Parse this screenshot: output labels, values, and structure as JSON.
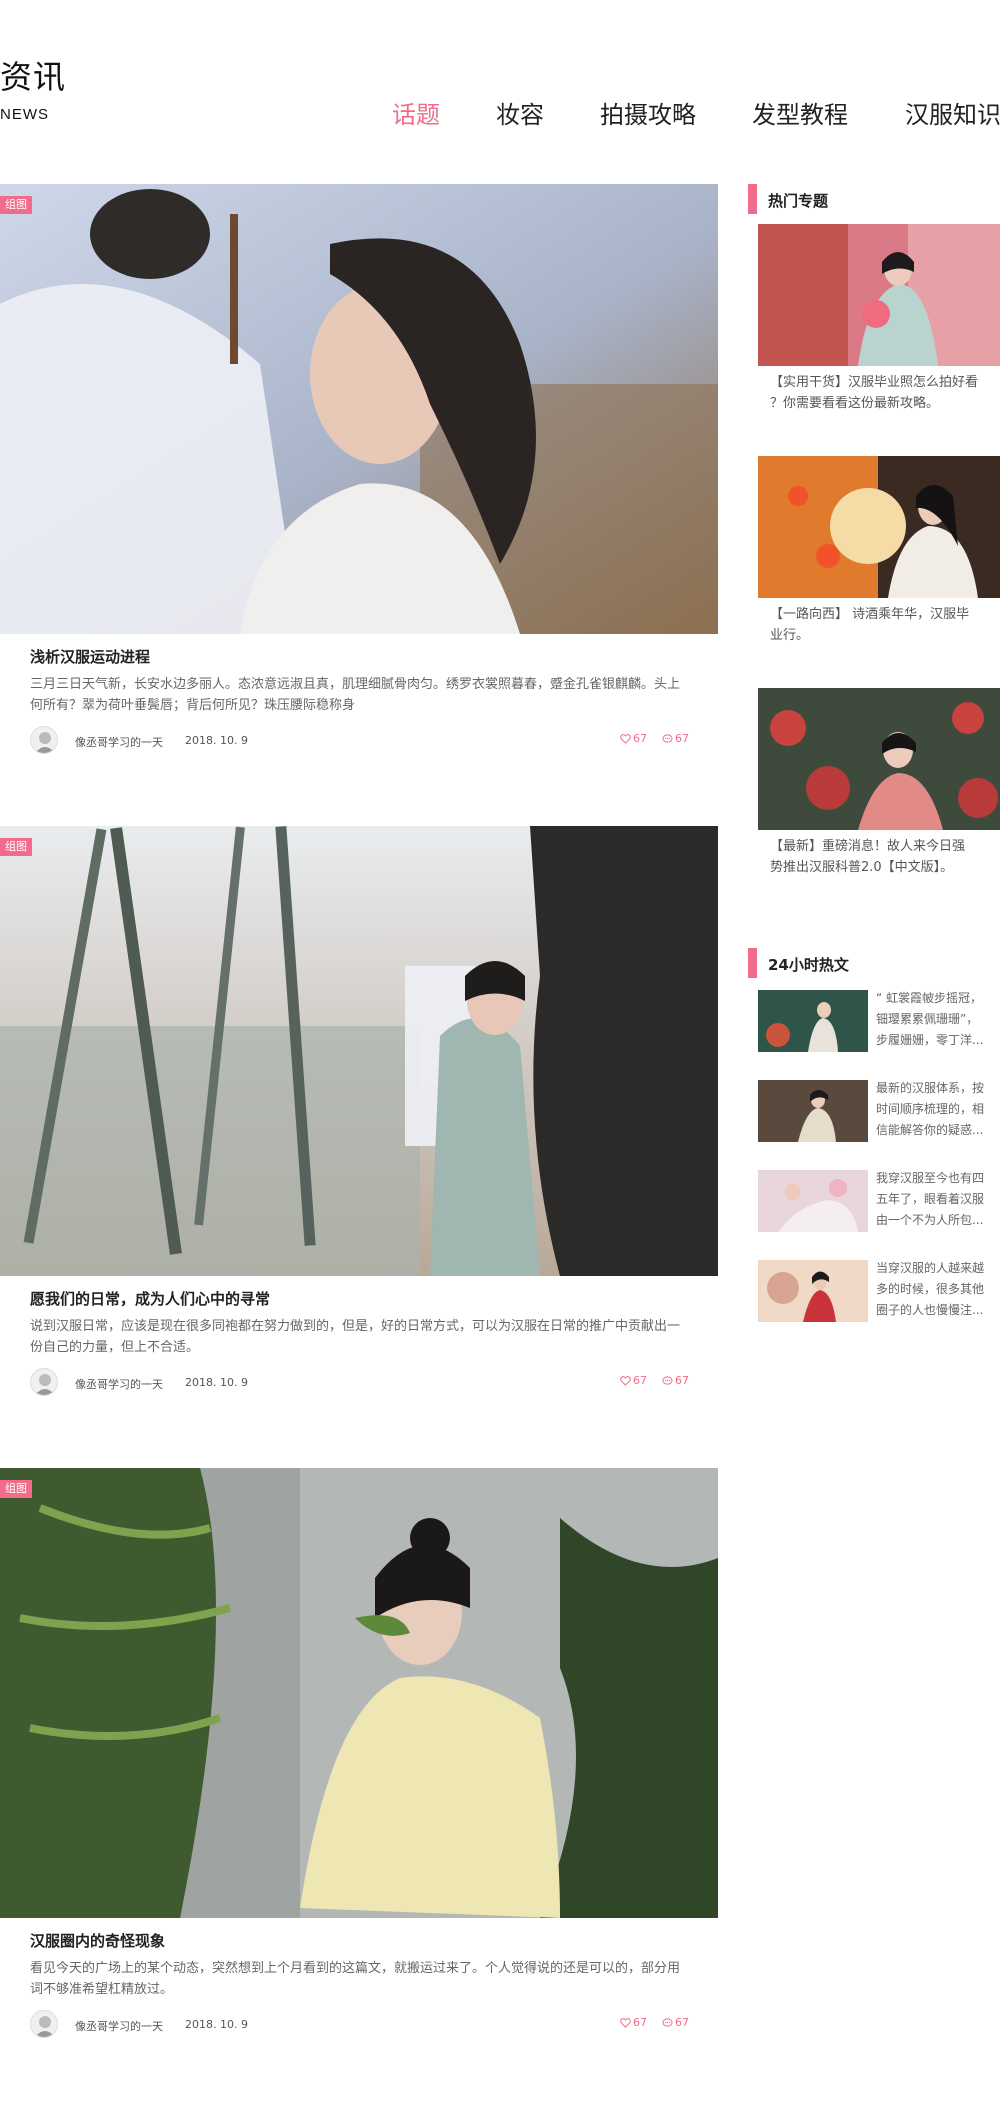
{
  "header": {
    "title": "资讯",
    "subtitle": "NEWS"
  },
  "nav": [
    {
      "label": "话题",
      "active": true
    },
    {
      "label": "妆容",
      "active": false
    },
    {
      "label": "拍摄攻略",
      "active": false
    },
    {
      "label": "发型教程",
      "active": false
    },
    {
      "label": "汉服知识",
      "active": false
    }
  ],
  "articles": [
    {
      "tag": "组图",
      "title": "浅析汉服运动进程",
      "desc": "三月三日天气新，长安水边多丽人。态浓意远淑且真，肌理细腻骨肉匀。绣罗衣裳照暮春，蹙金孔雀银麒麟。头上何所有？翠为荷叶垂鬓唇；背后何所见？珠压腰际稳称身",
      "author": "像丞哥学习的一天",
      "date": "2018. 10. 9",
      "likes": "67",
      "comments": "67"
    },
    {
      "tag": "组图",
      "title": "愿我们的日常，成为人们心中的寻常",
      "desc": "说到汉服日常，应该是现在很多同袍都在努力做到的，但是，好的日常方式，可以为汉服在日常的推广中贡献出一份自己的力量，但上不合适。",
      "author": "像丞哥学习的一天",
      "date": "2018. 10. 9",
      "likes": "67",
      "comments": "67"
    },
    {
      "tag": "组图",
      "title": "汉服圈内的奇怪现象",
      "desc": "看见今天的广场上的某个动态，突然想到上个月看到的这篇文，就搬运过来了。个人觉得说的还是可以的，部分用词不够准希望杠精放过。",
      "author": "像丞哥学习的一天",
      "date": "2018. 10. 9",
      "likes": "67",
      "comments": "67"
    }
  ],
  "sidebar": {
    "topics_heading": "热门专题",
    "topics": [
      {
        "line1": "【实用干货】汉服毕业照怎么拍好看",
        "line2": "？你需要看看这份最新攻略。"
      },
      {
        "line1": "【一路向西】 诗酒乘年华，汉服毕",
        "line2": "业行。"
      },
      {
        "line1": "【最新】重磅消息！故人来今日强",
        "line2": "势推出汉服科普2.0【中文版】。"
      }
    ],
    "hot_heading": "24小时热文",
    "hot": [
      {
        "l1": "“ 虹裳霞帔步摇冠，",
        "l2": "钿璎累累佩珊珊”，",
        "l3": "步履姗姗，零丁洋..."
      },
      {
        "l1": "最新的汉服体系，按",
        "l2": "时间顺序梳理的，相",
        "l3": "信能解答你的疑惑..."
      },
      {
        "l1": "我穿汉服至今也有四",
        "l2": "五年了，眼看着汉服",
        "l3": "由一个不为人所包..."
      },
      {
        "l1": "当穿汉服的人越来越",
        "l2": "多的时候，很多其他",
        "l3": "圈子的人也慢慢注..."
      }
    ]
  },
  "colors": {
    "accent": "#f06c8a"
  },
  "icons": [
    "heart-icon",
    "comment-icon",
    "avatar-icon"
  ]
}
